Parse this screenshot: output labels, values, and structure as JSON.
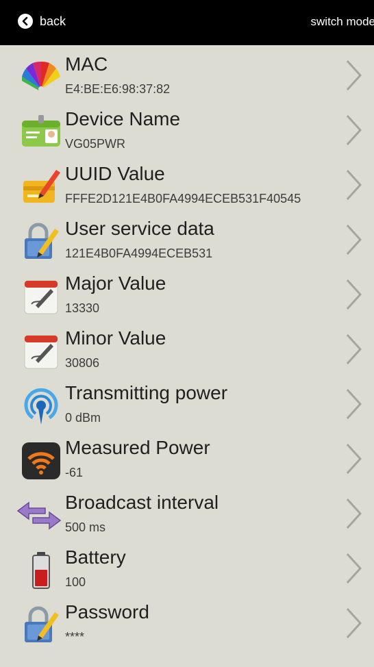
{
  "header": {
    "back_label": "back",
    "switch_label": "switch mode"
  },
  "items": [
    {
      "title": "MAC",
      "value": "E4:BE:E6:98:37:82",
      "icon": "color-fan-icon"
    },
    {
      "title": "Device Name",
      "value": "VG05PWR",
      "icon": "id-card-icon"
    },
    {
      "title": "UUID Value",
      "value": "FFFE2D121E4B0FA4994ECEB531F40545",
      "icon": "card-pencil-icon"
    },
    {
      "title": "User service data",
      "value": "121E4B0FA4994ECEB531",
      "icon": "lock-pencil-icon"
    },
    {
      "title": "Major Value",
      "value": "13330",
      "icon": "calendar-pencil-icon"
    },
    {
      "title": "Minor Value",
      "value": "30806",
      "icon": "calendar-pencil-icon"
    },
    {
      "title": "Transmitting power",
      "value": "0 dBm",
      "icon": "signal-pin-icon"
    },
    {
      "title": "Measured Power",
      "value": "-61",
      "icon": "wifi-icon"
    },
    {
      "title": "Broadcast interval",
      "value": "500 ms",
      "icon": "double-arrow-icon"
    },
    {
      "title": "Battery",
      "value": "100",
      "icon": "battery-icon"
    },
    {
      "title": "Password",
      "value": "****",
      "icon": "lock-pencil-icon"
    }
  ]
}
